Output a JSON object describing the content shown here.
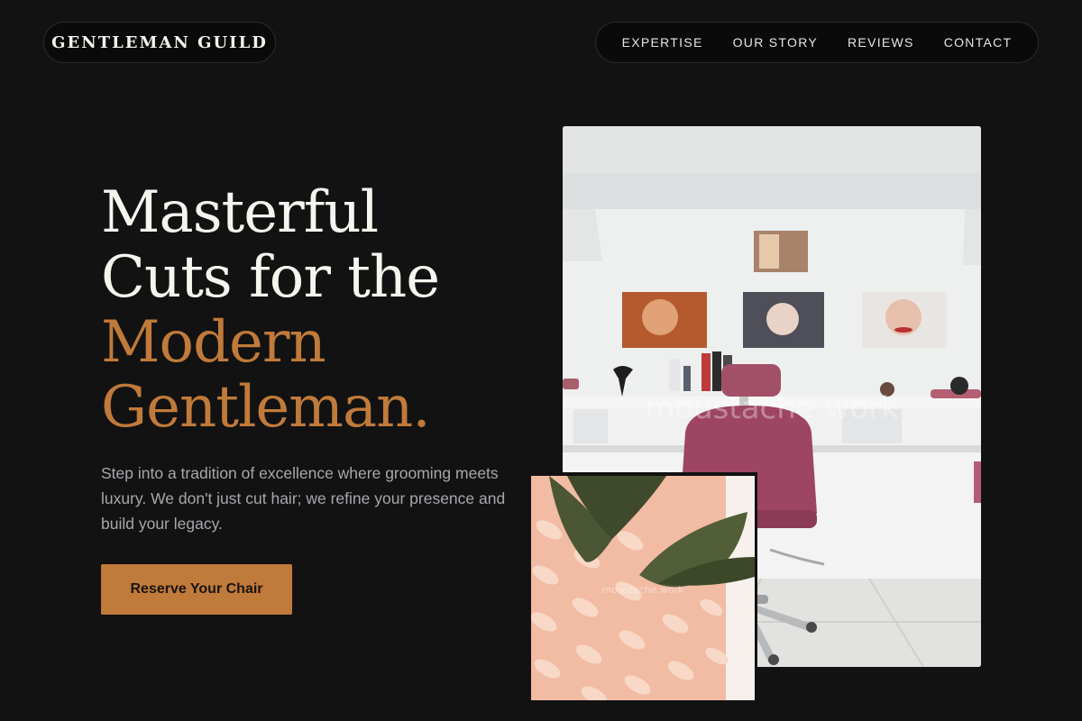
{
  "header": {
    "logo": "GENTLEMAN GUILD",
    "nav": [
      {
        "label": "EXPERTISE"
      },
      {
        "label": "OUR STORY"
      },
      {
        "label": "REVIEWS"
      },
      {
        "label": "CONTACT"
      }
    ]
  },
  "hero": {
    "headline": {
      "line1": "Masterful",
      "line2": "Cuts for the",
      "line3": "Modern",
      "line4": "Gentleman."
    },
    "lead": "Step into a tradition of excellence where grooming meets luxury. We don't just cut hair; we refine your presence and build your legacy.",
    "cta_label": "Reserve Your Chair"
  },
  "images": {
    "main_watermark": "moustache.work",
    "small_watermark": "moustache.work"
  },
  "colors": {
    "background": "#121212",
    "accent": "#c07a3a",
    "text_primary": "#f6f4ef",
    "text_muted": "#a6a8ad"
  }
}
